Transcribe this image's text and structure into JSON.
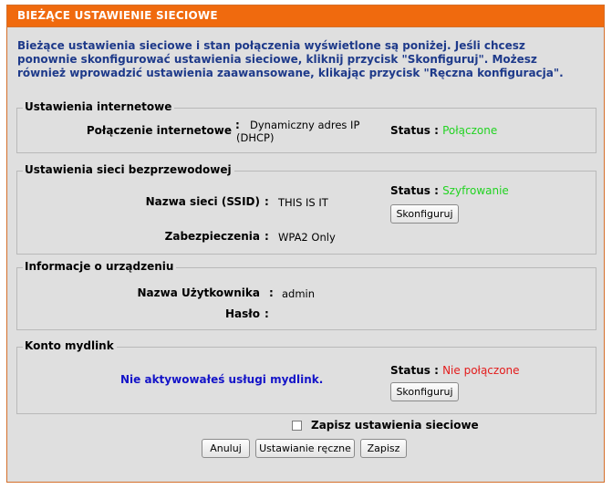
{
  "header": {
    "title": "BIEŻĄCE USTAWIENIE SIECIOWE"
  },
  "intro": {
    "text": "Bieżące ustawienia sieciowe i stan połączenia wyświetlone są poniżej. Jeśli chcesz ponownie skonfigurować ustawienia sieciowe, kliknij przycisk \"Skonfiguruj\". Możesz również wprowadzić ustawienia zaawansowane, klikając przycisk \"Ręczna konfiguracja\"."
  },
  "internet": {
    "legend": "Ustawienia internetowe",
    "connection_label": "Połączenie internetowe",
    "colon": ":",
    "connection_value": "Dynamiczny adres IP (DHCP)",
    "status_label": "Status :",
    "status_value": "Połączone",
    "status_color": "#22d322"
  },
  "wireless": {
    "legend": "Ustawienia sieci bezprzewodowej",
    "ssid_label": "Nazwa sieci (SSID)",
    "colon": ":",
    "ssid_value": "THIS IS IT",
    "security_label": "Zabezpieczenia",
    "security_value": "WPA2 Only",
    "status_label": "Status :",
    "status_value": "Szyfrowanie",
    "status_color": "#22d322",
    "configure_button": "Skonfiguruj"
  },
  "device": {
    "legend": "Informacje o urządzeniu",
    "user_label": "Nazwa Użytkownika",
    "colon": ":",
    "user_value": "admin",
    "password_label": "Hasło",
    "password_value": ""
  },
  "mydlink": {
    "legend": "Konto mydlink",
    "message": "Nie aktywowałeś usługi mydlink.",
    "message_color": "#1414c8",
    "status_label": "Status :",
    "status_value": "Nie połączone",
    "status_color": "#e31b1b",
    "configure_button": "Skonfiguruj"
  },
  "save_settings": {
    "label": "Zapisz ustawienia sieciowe",
    "checked": false
  },
  "buttons": {
    "cancel": "Anuluj",
    "manual": "Ustawianie ręczne",
    "save": "Zapisz"
  },
  "colors": {
    "header_bg": "#f06a0e",
    "panel_bg": "#dfdfdf",
    "intro_text": "#1e3a8a"
  }
}
